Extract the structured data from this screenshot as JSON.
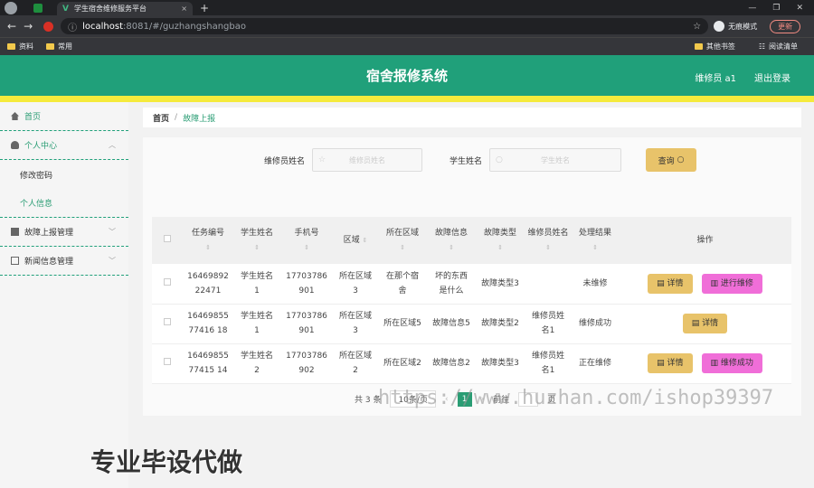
{
  "browser": {
    "tab_title": "学生宿舍维修服务平台",
    "url_host": "localhost",
    "url_path": ":8081/#/guzhangshangbao",
    "incognito_label": "无痕模式",
    "update_label": "更新",
    "bookmarks": [
      "资料",
      "常用"
    ],
    "bookmarks_right": [
      "其他书签",
      "阅读清单"
    ]
  },
  "header": {
    "title": "宿舍报修系统",
    "user": "维修员 a1",
    "logout": "退出登录"
  },
  "sidebar": {
    "items": [
      {
        "label": "首页"
      },
      {
        "label": "个人中心",
        "sub": [
          "修改密码",
          "个人信息"
        ]
      },
      {
        "label": "故障上报管理"
      },
      {
        "label": "新闻信息管理"
      }
    ]
  },
  "breadcrumb": {
    "home": "首页",
    "current": "故障上报"
  },
  "search": {
    "label1": "维修员姓名",
    "placeholder1": "维修员姓名",
    "label2": "学生姓名",
    "placeholder2": "学生姓名",
    "button": "查询"
  },
  "table": {
    "headers": [
      "任务编号",
      "学生姓名",
      "手机号",
      "区域",
      "所在区域",
      "故障信息",
      "故障类型",
      "维修员姓名",
      "处理结果",
      "操作"
    ],
    "rows": [
      {
        "id": "1646989222471",
        "student": "学生姓名1",
        "phone": "17703786901",
        "area": "所在区域3",
        "location": "在那个宿舍",
        "fault": "坏的东西是什么",
        "type": "故障类型3",
        "worker": "",
        "result": "未维修",
        "btn1": "详情",
        "btn2": "进行维修"
      },
      {
        "id": "1646985577416 18",
        "student": "学生姓名1",
        "phone": "17703786901",
        "area": "所在区域3",
        "location": "所在区域5",
        "fault": "故障信息5",
        "type": "故障类型2",
        "worker": "维修员姓名1",
        "result": "维修成功",
        "btn1": "详情",
        "btn2": ""
      },
      {
        "id": "1646985577415 14",
        "student": "学生姓名2",
        "phone": "17703786902",
        "area": "所在区域2",
        "location": "所在区域2",
        "fault": "故障信息2",
        "type": "故障类型3",
        "worker": "维修员姓名1",
        "result": "正在维修",
        "btn1": "详情",
        "btn2": "维修成功"
      }
    ]
  },
  "pager": {
    "total": "共 3 条",
    "size": "10条/页",
    "current": "1",
    "goto": "前往",
    "page_unit": "页"
  },
  "watermark": "https://www.huzhan.com/ishop39397",
  "promo": "专业毕设代做"
}
